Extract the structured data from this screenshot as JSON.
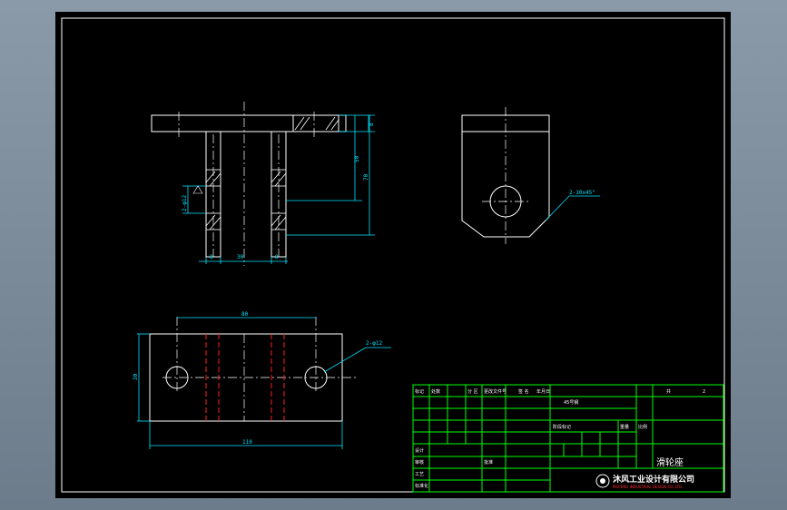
{
  "drawing": {
    "dims": {
      "front_top_thk": "8",
      "front_h1": "50",
      "front_h2": "70",
      "front_hole_note": "2-φ12",
      "front_w_left": "8",
      "front_w_mid": "30",
      "front_w_right": "8",
      "side_chamfer": "2-10x45°",
      "plan_span": "80",
      "plan_hole": "2-φ12",
      "plan_height": "30",
      "plan_width": "110"
    }
  },
  "title_block": {
    "title": "滑轮座",
    "company": "沐风工业设计有限公司",
    "company_sub": "MUFENG INDUSTRIAL DESIGN CO.,LTD",
    "row1": [
      "标记",
      "处数",
      "分 区",
      "更改文件号",
      "签 名",
      "年月日"
    ],
    "row1_right": [
      "共",
      "张",
      "第",
      "张"
    ],
    "sheet_count": "2",
    "material": "45号钢",
    "labels": [
      "设计",
      "审核",
      "工艺",
      "标准化",
      "批准",
      "阶段标记",
      "重量",
      "比例"
    ],
    "labels_right": [
      "图样",
      "名称",
      "图号"
    ]
  },
  "colors": {
    "outline": "#ffffff",
    "dimension": "#00e5ff",
    "border": "#00ff00",
    "hidden": "#ff2020"
  }
}
